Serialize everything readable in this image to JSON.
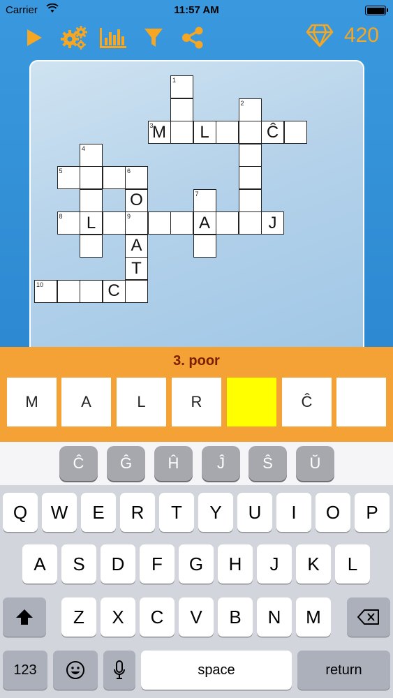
{
  "status_bar": {
    "carrier": "Carrier",
    "time": "11:57 AM"
  },
  "toolbar": {
    "icons": [
      "play-icon",
      "settings-gears-icon",
      "statistics-chart-icon",
      "filter-icon",
      "share-icon",
      "diamond-icon"
    ],
    "gem_count": "420",
    "accent_color": "#f5a623"
  },
  "puzzle": {
    "cells": [
      {
        "id": "r0c6",
        "num": "1",
        "letter": ""
      },
      {
        "id": "r1c6",
        "num": "",
        "letter": ""
      },
      {
        "id": "r1c9",
        "num": "2",
        "letter": ""
      },
      {
        "id": "r2c5",
        "num": "3",
        "letter": "M"
      },
      {
        "id": "r2c6",
        "num": "",
        "letter": ""
      },
      {
        "id": "r2c7",
        "num": "",
        "letter": "L"
      },
      {
        "id": "r2c8",
        "num": "",
        "letter": ""
      },
      {
        "id": "r2c9",
        "num": "",
        "letter": ""
      },
      {
        "id": "r2c10",
        "num": "",
        "letter": "Ĉ"
      },
      {
        "id": "r2c11",
        "num": "",
        "letter": ""
      },
      {
        "id": "r3c2",
        "num": "4",
        "letter": ""
      },
      {
        "id": "r3c9",
        "num": "",
        "letter": ""
      },
      {
        "id": "r4c1",
        "num": "5",
        "letter": ""
      },
      {
        "id": "r4c2",
        "num": "",
        "letter": ""
      },
      {
        "id": "r4c3",
        "num": "",
        "letter": ""
      },
      {
        "id": "r4c4",
        "num": "6",
        "letter": ""
      },
      {
        "id": "r4c9",
        "num": "",
        "letter": ""
      },
      {
        "id": "r5c2",
        "num": "",
        "letter": ""
      },
      {
        "id": "r5c4",
        "num": "",
        "letter": "O"
      },
      {
        "id": "r5c7",
        "num": "7",
        "letter": ""
      },
      {
        "id": "r5c9",
        "num": "",
        "letter": ""
      },
      {
        "id": "r6c1",
        "num": "8",
        "letter": ""
      },
      {
        "id": "r6c2",
        "num": "",
        "letter": "L"
      },
      {
        "id": "r6c3",
        "num": "",
        "letter": ""
      },
      {
        "id": "r6c4",
        "num": "9",
        "letter": ""
      },
      {
        "id": "r6c5",
        "num": "",
        "letter": ""
      },
      {
        "id": "r6c6",
        "num": "",
        "letter": ""
      },
      {
        "id": "r6c7",
        "num": "",
        "letter": "A"
      },
      {
        "id": "r6c8",
        "num": "",
        "letter": ""
      },
      {
        "id": "r6c9",
        "num": "",
        "letter": ""
      },
      {
        "id": "r6c10",
        "num": "",
        "letter": "J"
      },
      {
        "id": "r7c2",
        "num": "",
        "letter": ""
      },
      {
        "id": "r7c4",
        "num": "",
        "letter": "A"
      },
      {
        "id": "r7c7",
        "num": "",
        "letter": ""
      },
      {
        "id": "r8c4",
        "num": "",
        "letter": "T"
      },
      {
        "id": "r9c0",
        "num": "10",
        "letter": ""
      },
      {
        "id": "r9c1",
        "num": "",
        "letter": ""
      },
      {
        "id": "r9c2",
        "num": "",
        "letter": ""
      },
      {
        "id": "r9c3",
        "num": "",
        "letter": "C"
      },
      {
        "id": "r9c4",
        "num": "",
        "letter": ""
      }
    ]
  },
  "clue": {
    "title": "3. poor",
    "answer": [
      "M",
      "A",
      "L",
      "R",
      "",
      "Ĉ",
      ""
    ],
    "active_index": 4,
    "highlight_color": "#ffff00"
  },
  "accent_keys": [
    "Ĉ",
    "Ĝ",
    "Ĥ",
    "Ĵ",
    "Ŝ",
    "Ŭ"
  ],
  "keyboard": {
    "row1": [
      "Q",
      "W",
      "E",
      "R",
      "T",
      "Y",
      "U",
      "I",
      "O",
      "P"
    ],
    "row2": [
      "A",
      "S",
      "D",
      "F",
      "G",
      "H",
      "J",
      "K",
      "L"
    ],
    "row3": [
      "Z",
      "X",
      "C",
      "V",
      "B",
      "N",
      "M"
    ],
    "numbers_label": "123",
    "space_label": "space",
    "return_label": "return"
  }
}
